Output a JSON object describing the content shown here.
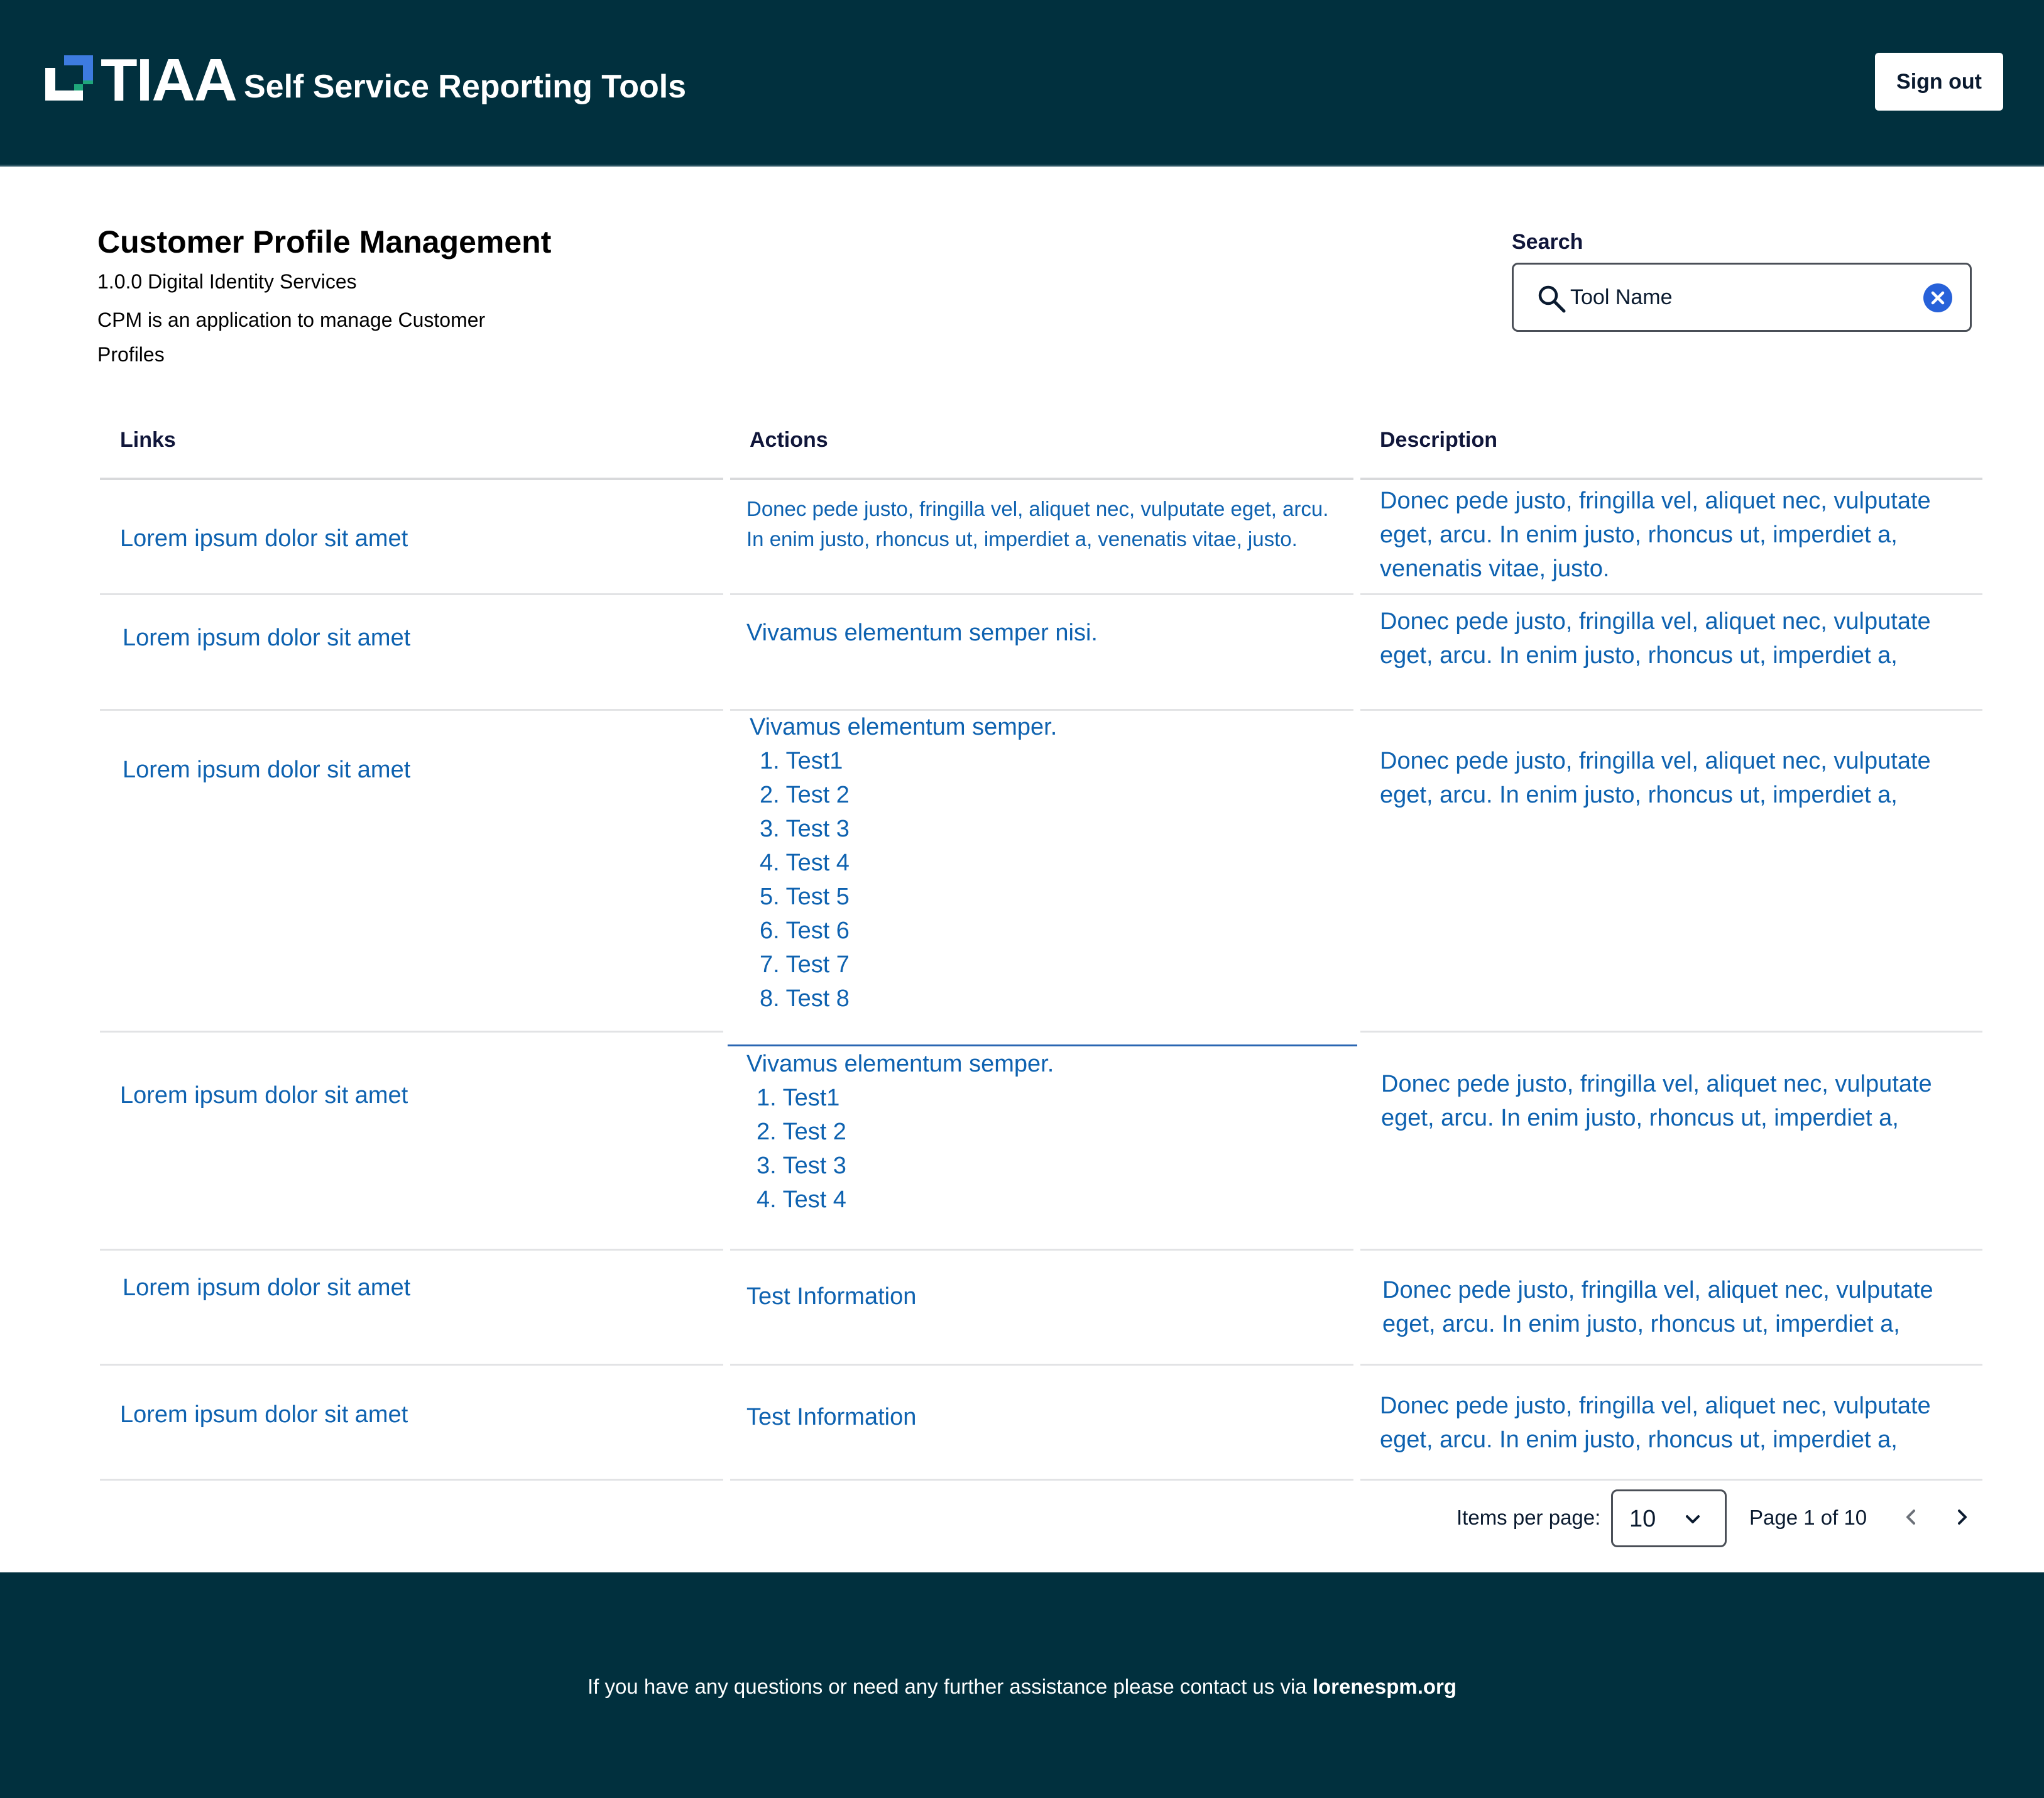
{
  "header": {
    "logo_text": "TIAA",
    "app_title": "Self Service Reporting Tools",
    "sign_out_label": "Sign out"
  },
  "page": {
    "title": "Customer Profile Management",
    "version_line": "1.0.0 Digital Identity Services",
    "description": "CPM is an application to manage Customer Profiles"
  },
  "search": {
    "label": "Search",
    "value": "Tool Name"
  },
  "table": {
    "columns": [
      "Links",
      "Actions",
      "Description"
    ],
    "rows": [
      {
        "link": "Lorem ipsum dolor sit amet",
        "action": "Donec pede justo, fringilla vel, aliquet nec, vulputate eget, arcu. In enim justo, rhoncus ut, imperdiet a, venenatis vitae, justo.",
        "description": "Donec pede justo, fringilla vel, aliquet nec, vulputate eget, arcu. In enim justo, rhoncus ut, imperdiet a, venenatis vitae, justo."
      },
      {
        "link": "Lorem ipsum dolor sit amet",
        "action": "Vivamus elementum semper nisi.",
        "description": "Donec pede justo, fringilla vel, aliquet nec, vulputate eget, arcu. In enim justo, rhoncus ut, imperdiet a,"
      },
      {
        "link": "Lorem ipsum dolor sit amet",
        "action": "Vivamus elementum semper.",
        "action_items": [
          "1. Test1",
          "2. Test 2",
          "3. Test 3",
          "4. Test 4",
          "5. Test 5",
          "6. Test 6",
          "7. Test 7",
          "8. Test 8"
        ],
        "description": "Donec pede justo, fringilla vel, aliquet nec, vulputate eget, arcu. In enim justo, rhoncus ut, imperdiet a,"
      },
      {
        "link": "Lorem ipsum dolor sit amet",
        "action": "Vivamus elementum semper.",
        "action_items": [
          "1. Test1",
          "2. Test 2",
          "3. Test 3",
          "4. Test 4"
        ],
        "description": "Donec pede justo, fringilla vel, aliquet nec, vulputate eget, arcu. In enim justo, rhoncus ut, imperdiet a,"
      },
      {
        "link": "Lorem ipsum dolor sit amet",
        "action": "Test Information",
        "description": "Donec pede justo, fringilla vel, aliquet nec, vulputate eget, arcu. In enim justo, rhoncus ut, imperdiet a,"
      },
      {
        "link": "Lorem ipsum dolor sit amet",
        "action": "Test Information",
        "description": "Donec pede justo, fringilla vel, aliquet nec, vulputate eget, arcu. In enim justo, rhoncus ut, imperdiet a,"
      }
    ]
  },
  "pagination": {
    "items_per_page_label": "Items per page:",
    "items_per_page_value": "10",
    "page_info": "Page 1 of 10"
  },
  "footer": {
    "text": "If you have any questions or need any further assistance please contact us via",
    "contact": "lorenespm.org"
  },
  "icons": {
    "logo": "tiaa-logo-mark",
    "search": "search-icon",
    "clear": "clear-circle-x-icon",
    "dropdown": "chevron-down-icon",
    "prev": "chevron-left-icon",
    "next": "chevron-right-icon"
  },
  "colors": {
    "header_bg": "#01303e",
    "link_blue": "#0e62b0",
    "clear_button": "#2761d9",
    "logo_green": "#1fa67a",
    "logo_blue": "#3d7be0"
  }
}
